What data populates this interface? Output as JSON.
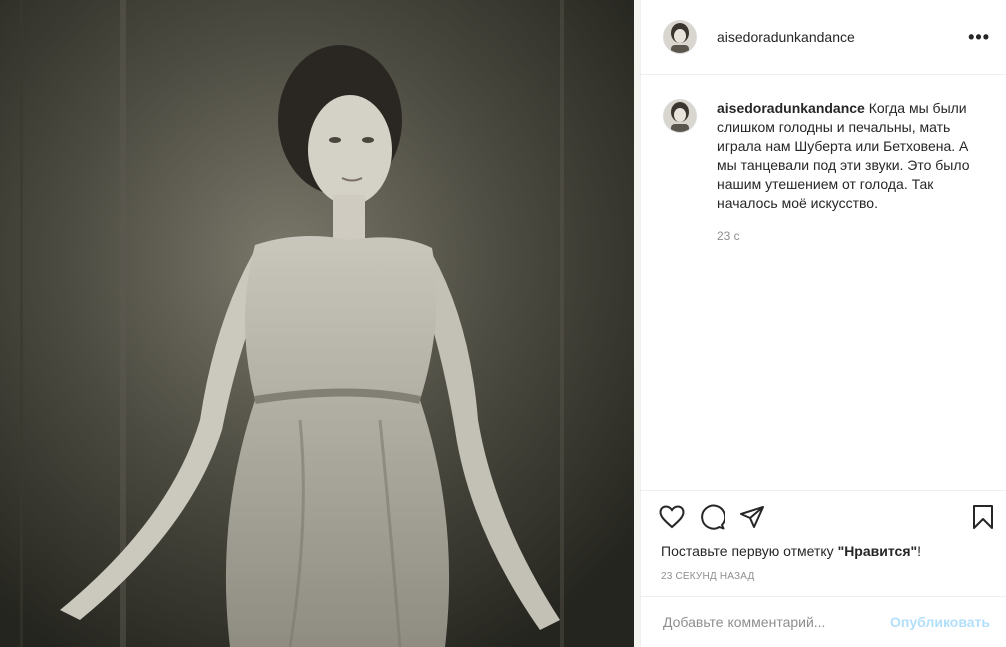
{
  "post": {
    "image_alt": "Портрет танцовщицы в лёгком платье",
    "author": "aisedoradunkandance",
    "caption": "Когда мы были слишком голодны и печальны, мать играла нам Шуберта или Бетховена. А мы танцевали под эти звуки. Это было нашим утешением от голода. Так началось моё искусство.",
    "caption_time": "23 с",
    "likes_text_pre": "Поставьте первую отметку ",
    "likes_text_bold": "\"Нравится\"",
    "likes_text_post": "!",
    "posted_ago": "23 секунд назад"
  },
  "comment_box": {
    "placeholder": "Добавьте комментарий...",
    "publish_label": "Опубликовать"
  },
  "icons": [
    "more-icon",
    "heart-icon",
    "comment-icon",
    "share-icon",
    "bookmark-icon"
  ]
}
